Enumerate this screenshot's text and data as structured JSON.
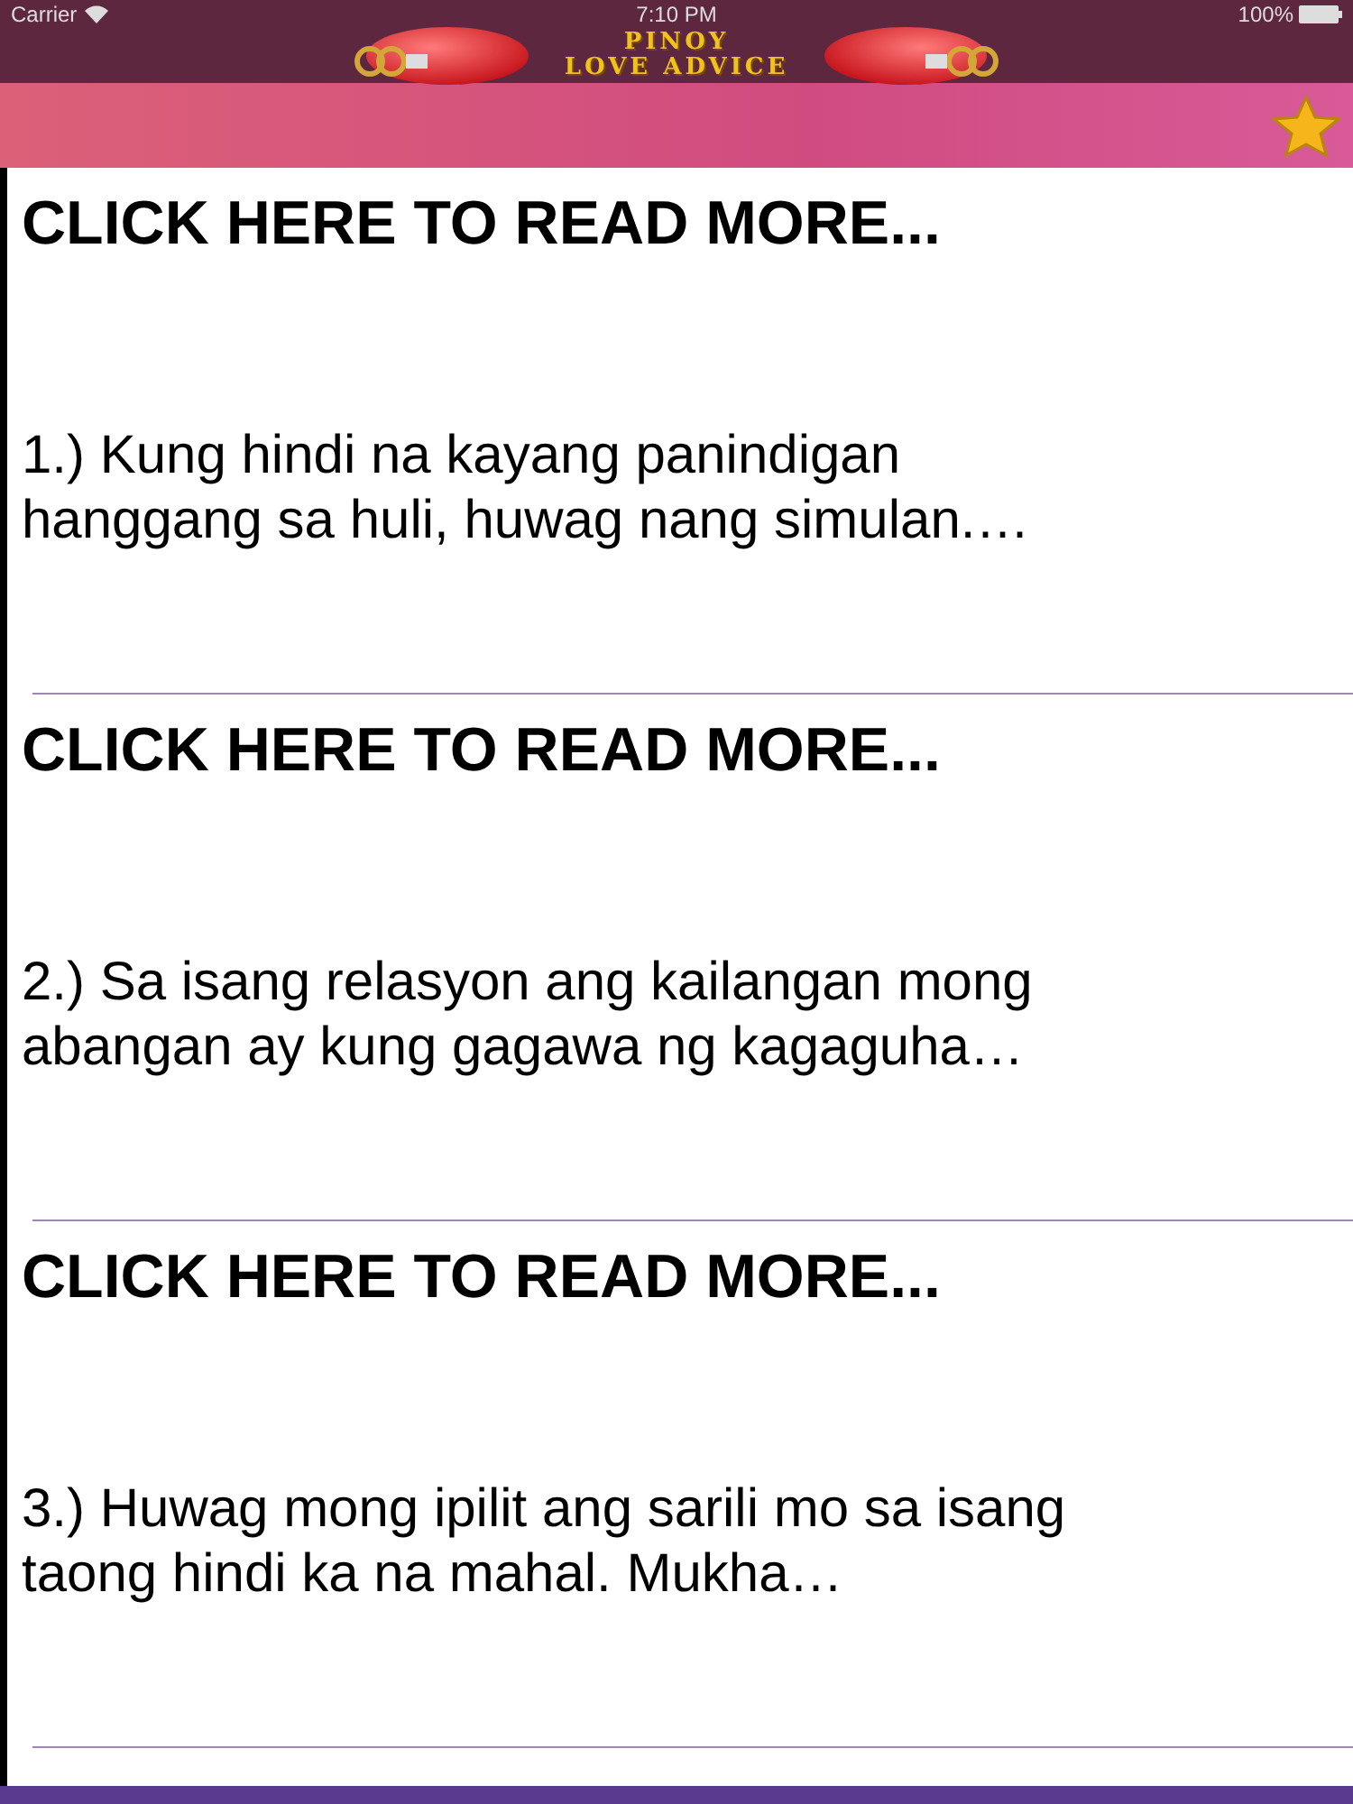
{
  "status_bar": {
    "carrier": "Carrier",
    "time": "7:10 PM",
    "battery": "100%"
  },
  "banner": {
    "title_line_1": "PINOY",
    "title_line_2": "LOVE ADVICE"
  },
  "toolbar": {
    "favorite": {
      "selected": true
    }
  },
  "items": [
    {
      "link": "CLICK HERE TO READ MORE...",
      "text": "1.) Kung hindi na kayang panindigan hanggang sa huli, huwag nang simulan.…"
    },
    {
      "link": "CLICK HERE TO READ MORE...",
      "text": "2.) Sa isang relasyon ang kailangan mong abangan ay kung gagawa ng kagaguha…"
    },
    {
      "link": "CLICK HERE TO READ MORE...",
      "text": "3.) Huwag mong ipilit ang sarili mo sa isang taong hindi ka na mahal. Mukha…"
    }
  ]
}
